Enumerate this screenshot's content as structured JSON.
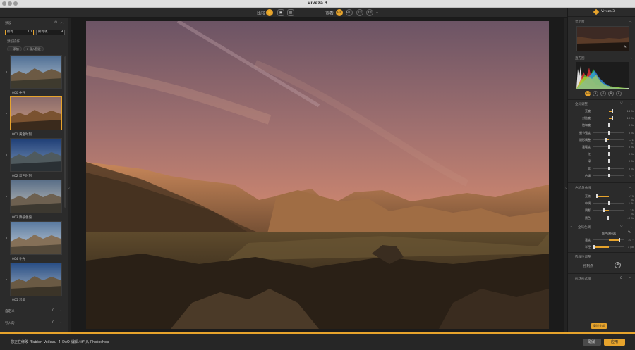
{
  "window": {
    "title": "Viveza 3"
  },
  "toolbar": {
    "compare_label": "比较",
    "preview_label": "查看",
    "zoom_buttons": [
      "FIT",
      "FILL",
      "1:1",
      "2:1"
    ],
    "zoom_menu": "⌄"
  },
  "left_panel": {
    "presets_title": "预设",
    "filter_field": "所有",
    "filter_value": "10",
    "sort_field": "所有项",
    "sort_value": "9",
    "subtitle": "预设操作",
    "add_button": "+ 添加",
    "import_button": "+ 导入预设",
    "presets": [
      {
        "label": "000 中性"
      },
      {
        "label": "001 黄金时刻"
      },
      {
        "label": "002 蓝色时刻"
      },
      {
        "label": "003 降低色偏"
      },
      {
        "label": "004 补光"
      },
      {
        "label": "005 混调"
      }
    ],
    "bottom_rows": [
      {
        "label": "自定义",
        "value": "0"
      },
      {
        "label": "导入的",
        "value": "0"
      }
    ]
  },
  "right_panel": {
    "brand": "Viveza 3",
    "navigator_title": "显示窗",
    "histogram_title": "直方图",
    "histogram_buttons": [
      "RGB",
      "R",
      "G",
      "B",
      "L"
    ],
    "global_title": "全局调整",
    "global_sliders": [
      {
        "label": "亮度",
        "value": "14 %",
        "pos": 0.62
      },
      {
        "label": "对比度",
        "value": "13 %",
        "pos": 0.62
      },
      {
        "label": "饱和度",
        "value": "0 %",
        "pos": 0.5
      },
      {
        "label": "细节强度",
        "value": "0 %",
        "pos": 0.5
      },
      {
        "label": "阴影调整",
        "value": "-21 %",
        "pos": 0.42
      },
      {
        "label": "温暖度",
        "value": "0 %",
        "pos": 0.5
      },
      {
        "label": "红",
        "value": "0 %",
        "pos": 0.5
      },
      {
        "label": "绿",
        "value": "0 %",
        "pos": 0.5
      },
      {
        "label": "蓝",
        "value": "0 %",
        "pos": 0.5
      },
      {
        "label": "色调",
        "value": "0 °",
        "pos": 0.5
      }
    ],
    "levels_title": "色阶与曲线",
    "levels_sliders": [
      {
        "label": "亮点",
        "value": "-79 %",
        "pos": 0.12
      },
      {
        "label": "中调",
        "value": "-1 %",
        "pos": 0.49
      },
      {
        "label": "阴影",
        "value": "-35 %",
        "pos": 0.35
      },
      {
        "label": "黑色",
        "value": "-3 %",
        "pos": 0.48
      }
    ],
    "control_point_title": "全局色调",
    "control_point_subtitle": "颜色选择器",
    "cp_sliders": [
      {
        "label": "温度",
        "value": "30 °",
        "pos": 0.85
      },
      {
        "label": "半径",
        "value": "1 px",
        "pos": 0.02
      }
    ],
    "selective_title": "选择性调整",
    "control_points_label": "控制点",
    "shape_title": "形状形选择",
    "shape_value": "0",
    "reset_button": "重设全部"
  },
  "status": {
    "message": "您正在修改 \"Fabien Voileau_4_DxO-编辑.tif\" 从 Photoshop",
    "cancel": "取消",
    "apply": "应用"
  }
}
